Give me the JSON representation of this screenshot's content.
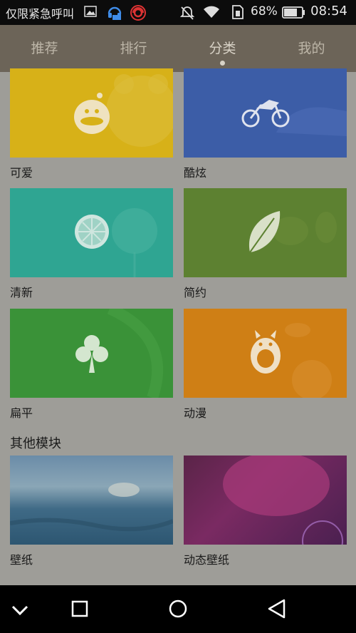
{
  "statusbar": {
    "notification_text": "仅限紧急呼叫",
    "battery_percent": "68%",
    "time": "08:54",
    "icons": [
      "image-icon",
      "headset-notification-icon",
      "record-icon",
      "mute-icon",
      "wifi-icon",
      "sim-icon",
      "battery-icon"
    ]
  },
  "tabs": [
    {
      "label": "推荐"
    },
    {
      "label": "排行"
    },
    {
      "label": "分类",
      "active": true
    },
    {
      "label": "我的"
    }
  ],
  "categories": [
    {
      "label": "可爱",
      "color": "#d7b118",
      "icon": "duck-icon"
    },
    {
      "label": "酷炫",
      "color": "#3c5da7",
      "icon": "motorcycle-icon"
    },
    {
      "label": "清新",
      "color": "#2fa592",
      "icon": "lemon-icon"
    },
    {
      "label": "简约",
      "color": "#5d8131",
      "icon": "leaf-icon"
    },
    {
      "label": "扁平",
      "color": "#3a9238",
      "icon": "clover-icon"
    },
    {
      "label": "动漫",
      "color": "#cf7f15",
      "icon": "totoro-icon"
    }
  ],
  "other_section": {
    "title": "其他模块",
    "items": [
      {
        "label": "壁纸"
      },
      {
        "label": "动态壁纸"
      }
    ]
  },
  "navbar": {
    "icons": [
      "collapse-icon",
      "recents-icon",
      "home-icon",
      "back-icon"
    ]
  }
}
